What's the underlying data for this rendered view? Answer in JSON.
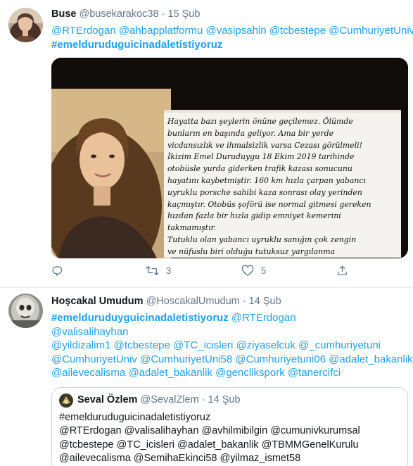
{
  "tweet1": {
    "name": "Buse",
    "handle": "@busekarakoc38",
    "separator": "·",
    "date": "15 Şub",
    "mentions": [
      "@RTErdogan",
      "@ahbapplatformu",
      "@vasipsahin",
      "@tcbestepe",
      "@CumhuriyetUniv"
    ],
    "hashtag": "#emelduruduguicinadaletistiyoruz",
    "image": {
      "note_lines": [
        "Hayatta bazı şeylerin önüne geçilemez. Ölümde",
        "bunların en başında geliyor. Ama bir yerde",
        "vicdansızlık ve ihmalsizlik varsa Cezası görülmeli!",
        "İkizim Emel Duruduygu 18 Ekim 2019 tarihinde",
        "otobüsle yurda giderken trafik kazası sonucunu",
        "hayatını kaybetmiştir.  160 km hızla çarpan yabancı",
        "uyruklu porsche sahibi kaza sonrası olay yerinden",
        "kaçmıştır. Otobüs şoförü ise normal gitmesi gereken",
        "hızdan fazla bir hızla gidip emniyet kemerini",
        "takmamıştır.",
        "Tutuklu olan yabancı uyruklu sanığın çok zengin",
        "ve nüfuslu biri olduğu tutuksuz yargılanma"
      ]
    },
    "actions": {
      "reply_count": "",
      "retweet_count": "3",
      "like_count": "5"
    }
  },
  "tweet2": {
    "name": "Hoşcakal Umudum",
    "handle": "@HoscakalUmudum",
    "separator": "·",
    "date": "14 Şub",
    "lines": [
      [
        {
          "text": "#emelduruduyguicinadaletistiyoruz",
          "kind": "tag"
        },
        {
          "text": " ",
          "kind": "space"
        },
        {
          "text": "@RTErdogan",
          "kind": "link"
        }
      ],
      [
        {
          "text": "@valisalihayhan",
          "kind": "link"
        }
      ],
      [
        {
          "text": "@yildizalim1",
          "kind": "link"
        },
        {
          "text": " ",
          "kind": "space"
        },
        {
          "text": "@tcbestepe",
          "kind": "link"
        },
        {
          "text": " ",
          "kind": "space"
        },
        {
          "text": "@TC_icisleri",
          "kind": "link"
        },
        {
          "text": " ",
          "kind": "space"
        },
        {
          "text": "@ziyaselcuk",
          "kind": "link"
        },
        {
          "text": " ",
          "kind": "space"
        },
        {
          "text": "@_cumhuriyetuni",
          "kind": "link"
        }
      ],
      [
        {
          "text": "@CumhuriyetUniv",
          "kind": "link"
        },
        {
          "text": " ",
          "kind": "space"
        },
        {
          "text": "@CumhuriyetUni58",
          "kind": "link"
        },
        {
          "text": " ",
          "kind": "space"
        },
        {
          "text": "@Cumhuriyetuni06",
          "kind": "link"
        },
        {
          "text": " ",
          "kind": "space"
        },
        {
          "text": "@adalet_bakanlik",
          "kind": "link"
        }
      ],
      [
        {
          "text": "@ailevecalisma",
          "kind": "link"
        },
        {
          "text": " ",
          "kind": "space"
        },
        {
          "text": "@adalet_bakanlik",
          "kind": "link"
        },
        {
          "text": " ",
          "kind": "space"
        },
        {
          "text": "@genclikspork",
          "kind": "link"
        },
        {
          "text": " ",
          "kind": "space"
        },
        {
          "text": "@tanercifci",
          "kind": "link"
        }
      ]
    ],
    "quote": {
      "name": "Seval Özlem",
      "handle": "@SevalZlem",
      "separator": "·",
      "date": "14 Şub",
      "lines": [
        "#emelduruduguicinadaletistiyoruz",
        "@RTErdogan @valisalihayhan @avhilmibilgin @cumunivkurumsal",
        "@tcbestepe @TC_icisleri @adalet_bakanlik @TBMMGenelKurulu",
        "@ailevecalisma @SemihaEkinci58 @yilmaz_ismet58"
      ]
    }
  },
  "colors": {
    "link": "#1da1f2",
    "muted": "#657786",
    "text": "#14171a",
    "border": "#e6ecf0"
  },
  "icons": [
    "reply-icon",
    "retweet-icon",
    "like-icon"
  ]
}
